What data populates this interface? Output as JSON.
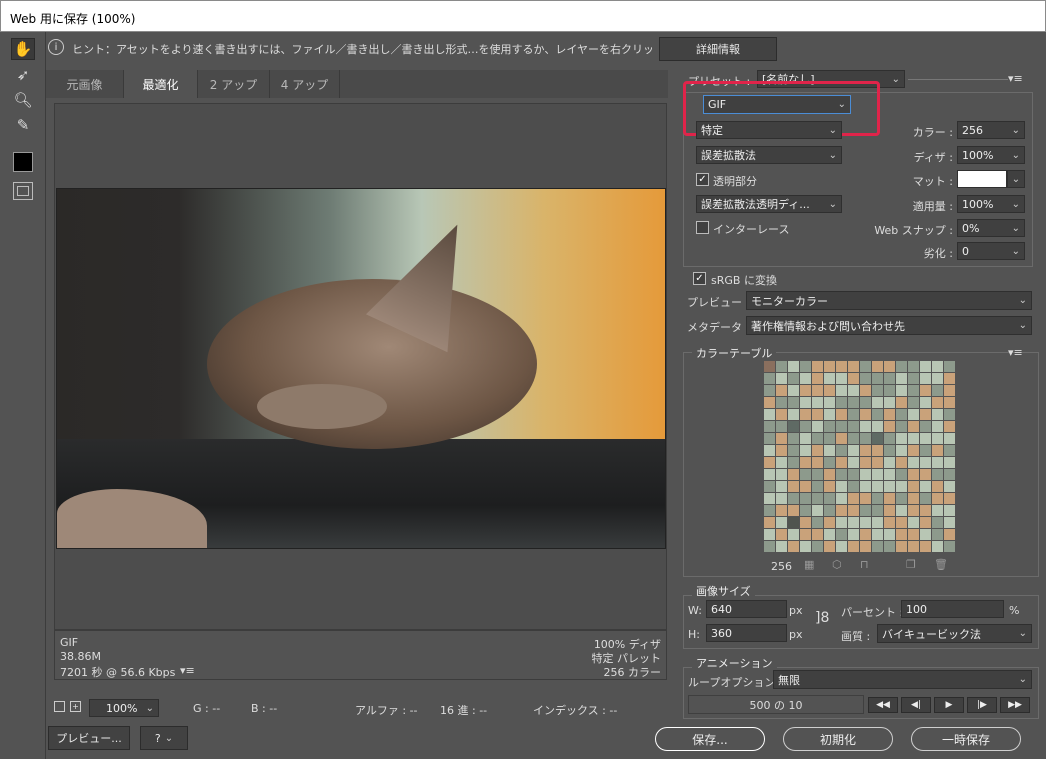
{
  "window": {
    "title": "Web 用に保存 (100%)"
  },
  "hint": {
    "text": "ヒント：アセットをより速く書き出すには、ファイル／書き出し／書き出し形式…を使用するか、レイヤーを右クリックして使用。",
    "details_button": "詳細情報"
  },
  "tabs": [
    "元画像",
    "最適化",
    "2 アップ",
    "4 アップ"
  ],
  "preview": {
    "format": "GIF",
    "size": "38.86M",
    "time": "7201 秒 @ 56.6 Kbps",
    "dither": "100% ディザ",
    "palette": "特定 パレット",
    "colors": "256 カラー"
  },
  "status": {
    "zoom": "100%",
    "g": "G : --",
    "b": "B : --",
    "alpha": "アルファ : --",
    "hex": "16 進 : --",
    "index": "インデックス : --"
  },
  "bottom_buttons": {
    "preview": "プレビュー...",
    "save": "保存...",
    "reset": "初期化",
    "temp_save": "一時保存"
  },
  "preset": {
    "label": "プリセット :",
    "value": "[名前なし]"
  },
  "settings": {
    "format": "GIF",
    "reduction": "特定",
    "dither_algo": "誤差拡散法",
    "transparency_label": "透明部分",
    "transparency_dither": "誤差拡散法透明ディ...",
    "interlace_label": "インターレース",
    "colors_label": "カラー :",
    "colors_value": "256",
    "dither_label": "ディザ :",
    "dither_value": "100%",
    "matte_label": "マット :",
    "amount_label": "適用量 :",
    "amount_value": "100%",
    "websnap_label": "Web スナップ :",
    "websnap_value": "0%",
    "lossy_label": "劣化 :",
    "lossy_value": "0",
    "srgb_label": "sRGB に変換",
    "preview_label": "プレビュー :",
    "preview_value": "モニターカラー",
    "metadata_label": "メタデータ :",
    "metadata_value": "著作権情報および問い合わせ先"
  },
  "color_table": {
    "title": "カラーテーブル",
    "count": "256"
  },
  "image_size": {
    "title": "画像サイズ",
    "w_label": "W:",
    "w_value": "640",
    "h_label": "H:",
    "h_value": "360",
    "unit": "px",
    "percent_label": "パーセント :",
    "percent_value": "100",
    "percent_unit": "%",
    "quality_label": "画質 :",
    "quality_value": "バイキュービック法"
  },
  "animation": {
    "title": "アニメーション",
    "loop_label": "ループオプション :",
    "loop_value": "無限",
    "frame": "500 の 10"
  },
  "colors": {
    "accent": "#4b8dd6",
    "highlight": "#e0244a",
    "bg": "#535353"
  }
}
